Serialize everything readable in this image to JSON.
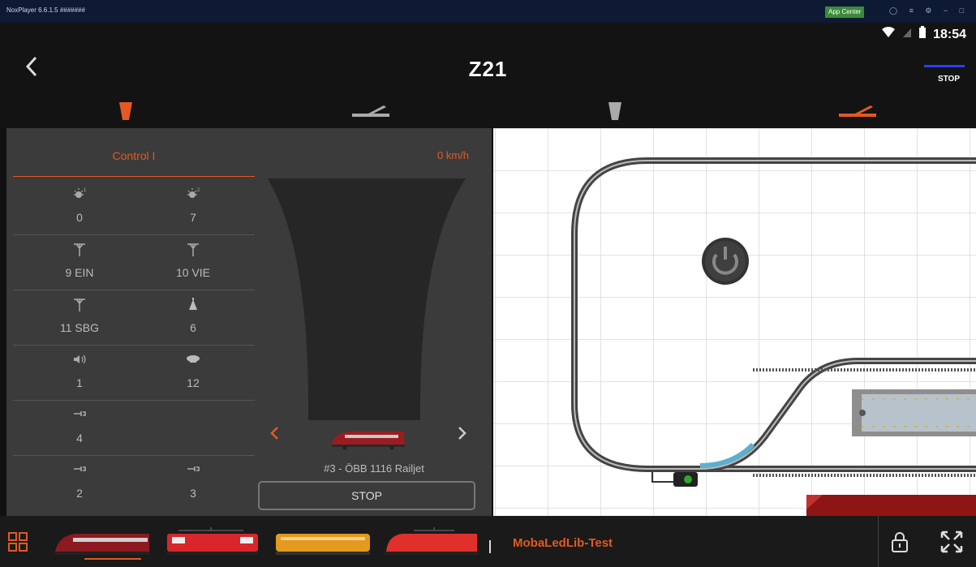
{
  "emulator": {
    "title": "NoxPlayer 6.6.1.5 #######",
    "app_center": "App Center",
    "controls": "◯ ≡ ⚙ − □ ×"
  },
  "status_bar": {
    "time": "18:54"
  },
  "header": {
    "back_icon": "chevron-left-icon",
    "title": "Z21",
    "stop_label": "STOP",
    "stop_line_color": "#2b3fff"
  },
  "mode_tabs": [
    {
      "icon": "throttle-icon",
      "color": "#e25a20",
      "selected": true
    },
    {
      "icon": "switch-icon",
      "color": "#aaaaaa"
    },
    {
      "icon": "throttle-icon",
      "color": "#aaaaaa"
    },
    {
      "icon": "switch-icon",
      "color": "#e25a20"
    }
  ],
  "control": {
    "name": "Control I",
    "speed": "0 km/h",
    "accent": "#e25a20",
    "functions": [
      [
        {
          "icon": "light-1-icon",
          "label": "0"
        },
        {
          "icon": "light-2-icon",
          "label": "7"
        }
      ],
      [
        {
          "icon": "pantograph-icon",
          "label": "9 EIN"
        },
        {
          "icon": "pantograph-icon",
          "label": "10 VIE"
        }
      ],
      [
        {
          "icon": "pantograph-icon",
          "label": "11 SBG"
        },
        {
          "icon": "bell-icon",
          "label": "6"
        }
      ],
      [
        {
          "icon": "sound-icon",
          "label": "1"
        },
        {
          "icon": "horn-icon",
          "label": "12"
        }
      ],
      [
        {
          "icon": "coupler-icon",
          "label": "4"
        },
        null
      ],
      [
        {
          "icon": "coupler-icon",
          "label": "2"
        },
        {
          "icon": "coupler-icon",
          "label": "3"
        }
      ]
    ],
    "loco_name": "#3 - ÖBB 1116 Railjet",
    "stop_label": "STOP"
  },
  "bottom": {
    "layout_name": "MobaLedLib-Test",
    "locos": [
      "railjet",
      "red-electric",
      "yellow-diesel",
      "red-electric-2"
    ]
  }
}
